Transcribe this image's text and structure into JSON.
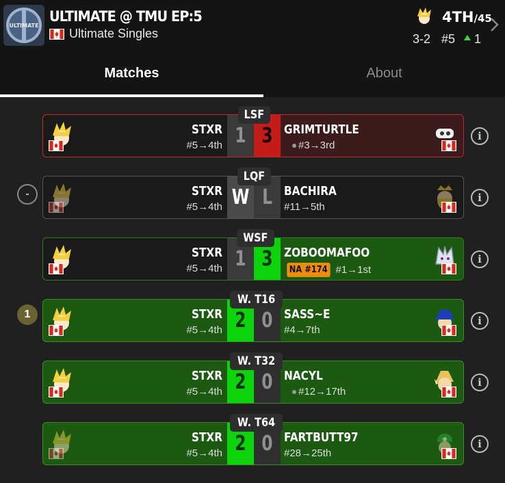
{
  "header": {
    "title": "ULTIMATE @ TMU EP:5",
    "subtitle": "Ultimate Singles",
    "placement": "4TH",
    "placement_total": "/45",
    "record": "3-2",
    "seed": "#5",
    "seed_delta": "1"
  },
  "tabs": {
    "matches": "Matches",
    "about": "About"
  },
  "matches": [
    {
      "round": "LSF",
      "left_name": "STXR",
      "left_seed": "#5→4th",
      "left_score": "1",
      "right_score": "3",
      "right_name": "GRIMTURTLE",
      "right_seed": "#3→3rd"
    },
    {
      "round": "LQF",
      "marker": "-",
      "left_name": "STXR",
      "left_seed": "#5→4th",
      "left_score": "W",
      "right_score": "L",
      "right_name": "BACHIRA",
      "right_seed": "#11→5th"
    },
    {
      "round": "WSF",
      "left_name": "STXR",
      "left_seed": "#5→4th",
      "left_score": "1",
      "right_score": "3",
      "right_name": "ZOBOOMAFOO",
      "right_badge": "NA #174",
      "right_seed": "#1→1st"
    },
    {
      "round": "W. T16",
      "marker": "1",
      "left_name": "STXR",
      "left_seed": "#5→4th",
      "left_score": "2",
      "right_score": "0",
      "right_name": "SASS~E",
      "right_seed": "#4→7th"
    },
    {
      "round": "W. T32",
      "left_name": "STXR",
      "left_seed": "#5→4th",
      "left_score": "2",
      "right_score": "0",
      "right_name": "NACYL",
      "right_seed": "#12→17th"
    },
    {
      "round": "W. T64",
      "left_name": "STXR",
      "left_seed": "#5→4th",
      "left_score": "2",
      "right_score": "0",
      "right_name": "FARTBUTT97",
      "right_seed": "#28→25th"
    }
  ],
  "colors": {
    "win_green": "#0cd30c",
    "loss_red": "#c41b1b",
    "badge_orange": "#f08c0c",
    "up_arrow": "#39d84a"
  }
}
